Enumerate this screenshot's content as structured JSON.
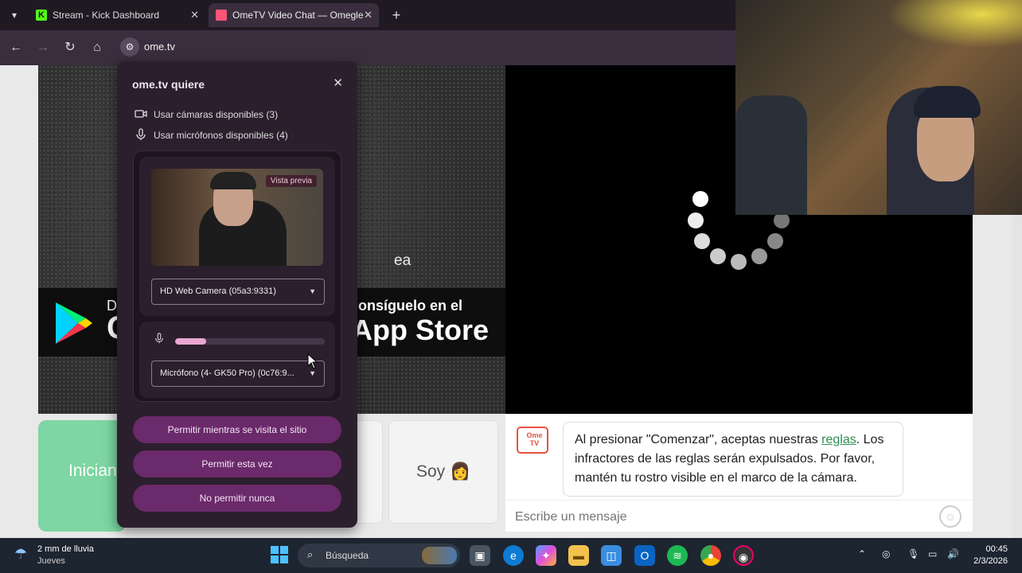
{
  "browser": {
    "tabs": [
      {
        "title": "Stream - Kick Dashboard",
        "close": "✕"
      },
      {
        "title": "OmeTV Video Chat — Omegle",
        "close": "✕"
      }
    ],
    "new_tab": "+",
    "url": "ome.tv"
  },
  "page": {
    "partial_text": "ea",
    "gplay": {
      "line1": "D",
      "line2": "C"
    },
    "appstore": {
      "line1": "onsíguelo en el",
      "line2": "App Store"
    },
    "start_button": "Inician",
    "soy_button": "Soy 👩",
    "chat": {
      "logo": "Ome TV",
      "message_before": "Al presionar \"Comenzar\", aceptas nuestras ",
      "rules_link": "reglas",
      "message_after": ". Los infractores de las reglas serán expulsados. Por favor, mantén tu rostro visible en el marco de la cámara.",
      "input_placeholder": "Escribe un mensaje",
      "emoji": "☺"
    }
  },
  "permission_dialog": {
    "title": "ome.tv quiere",
    "close": "✕",
    "camera_row": "Usar cámaras disponibles (3)",
    "mic_row": "Usar micrófonos disponibles (4)",
    "preview_badge": "Vista previa",
    "camera_select": "HD Web Camera (05a3:9331)",
    "mic_select": "Micrófono (4- GK50 Pro) (0c76:9...",
    "mic_level": 0.21,
    "buttons": {
      "allow_while_visiting": "Permitir mientras se visita el sitio",
      "allow_this_time": "Permitir esta vez",
      "never_allow": "No permitir nunca"
    }
  },
  "taskbar": {
    "weather_title": "2 mm de lluvia",
    "weather_sub": "Jueves",
    "search": "Búsqueda",
    "time": "00:45",
    "date": "2/3/2026"
  },
  "colors": {
    "accent_purple": "#6b2a6b",
    "chrome_dark": "#3a2e3e",
    "start_green": "#7dd6a3",
    "link_green": "#2f8d52"
  }
}
